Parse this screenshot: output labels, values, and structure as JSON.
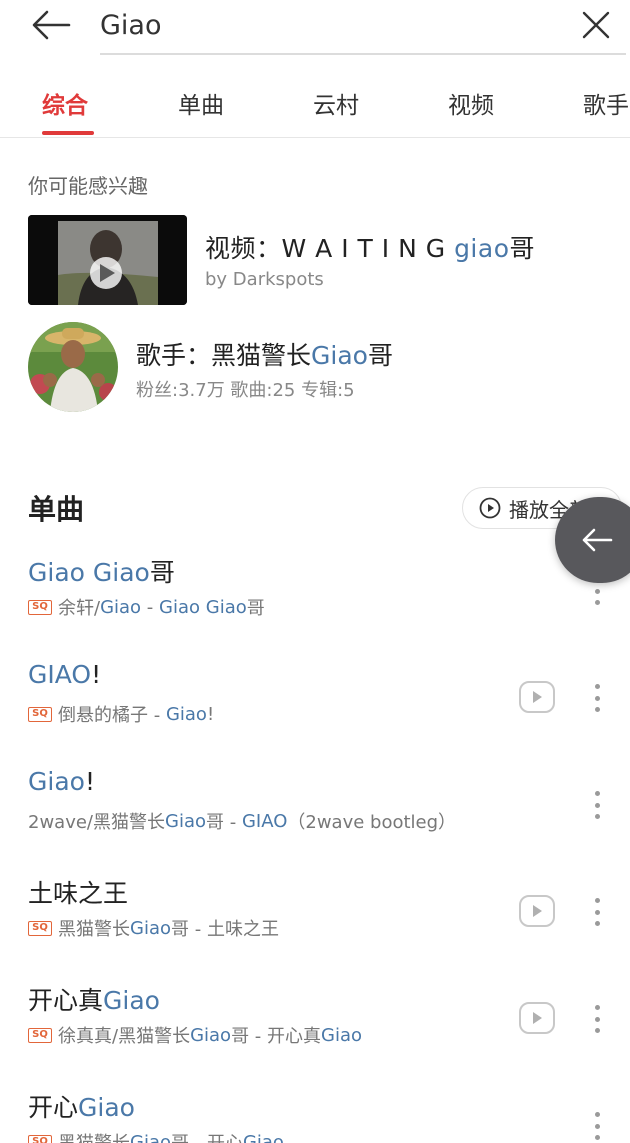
{
  "search": {
    "query": "Giao"
  },
  "tabs": [
    {
      "label": "综合",
      "active": true
    },
    {
      "label": "单曲",
      "active": false
    },
    {
      "label": "云村",
      "active": false
    },
    {
      "label": "视频",
      "active": false
    },
    {
      "label": "歌手",
      "active": false
    }
  ],
  "suggestions": {
    "heading": "你可能感兴趣",
    "video": {
      "prefix": "视频：",
      "title_plain": "W A I T I N G ",
      "title_highlight": "giao",
      "title_suffix": "哥",
      "by": "by Darkspots"
    },
    "artist": {
      "prefix": "歌手：",
      "name_plain": "黑猫警长",
      "name_highlight": "Giao",
      "name_suffix": "哥",
      "stats": "粉丝:3.7万 歌曲:25 专辑:5"
    }
  },
  "songs_section": {
    "heading": "单曲",
    "play_all": "播放全部"
  },
  "songs": [
    {
      "title": [
        {
          "t": "Giao Giao",
          "hl": true
        },
        {
          "t": "哥",
          "hl": false
        }
      ],
      "sub": [
        {
          "t": "余轩/",
          "hl": false
        },
        {
          "t": "Giao",
          "hl": true
        },
        {
          "t": " - ",
          "hl": false
        },
        {
          "t": "Giao Giao",
          "hl": true
        },
        {
          "t": "哥",
          "hl": false
        }
      ],
      "sq": true,
      "video": false
    },
    {
      "title": [
        {
          "t": "GIAO",
          "hl": true
        },
        {
          "t": "!",
          "hl": false
        }
      ],
      "sub": [
        {
          "t": "倒悬的橘子 - ",
          "hl": false
        },
        {
          "t": "Giao",
          "hl": true
        },
        {
          "t": "!",
          "hl": false
        }
      ],
      "sq": true,
      "video": true
    },
    {
      "title": [
        {
          "t": "Giao",
          "hl": true
        },
        {
          "t": "!",
          "hl": false
        }
      ],
      "sub": [
        {
          "t": "2wave/黑猫警长",
          "hl": false
        },
        {
          "t": "Giao",
          "hl": true
        },
        {
          "t": "哥 - ",
          "hl": false
        },
        {
          "t": "GIAO",
          "hl": true
        },
        {
          "t": "（2wave bootleg）",
          "hl": false
        }
      ],
      "sq": false,
      "video": false
    },
    {
      "title": [
        {
          "t": "土味之王",
          "hl": false
        }
      ],
      "sub": [
        {
          "t": "黑猫警长",
          "hl": false
        },
        {
          "t": "Giao",
          "hl": true
        },
        {
          "t": "哥 - 土味之王",
          "hl": false
        }
      ],
      "sq": true,
      "video": true
    },
    {
      "title": [
        {
          "t": "开心真",
          "hl": false
        },
        {
          "t": "Giao",
          "hl": true
        }
      ],
      "sub": [
        {
          "t": "徐真真/黑猫警长",
          "hl": false
        },
        {
          "t": "Giao",
          "hl": true
        },
        {
          "t": "哥 - 开心真",
          "hl": false
        },
        {
          "t": "Giao",
          "hl": true
        }
      ],
      "sq": true,
      "video": true
    },
    {
      "title": [
        {
          "t": "开心",
          "hl": false
        },
        {
          "t": "Giao",
          "hl": true
        }
      ],
      "sub": [
        {
          "t": "黑猫警长",
          "hl": false
        },
        {
          "t": "Giao",
          "hl": true
        },
        {
          "t": "哥 - 开心",
          "hl": false
        },
        {
          "t": "Giao",
          "hl": true
        }
      ],
      "sq": true,
      "video": false
    }
  ],
  "badges": {
    "sq_label": "SQ"
  },
  "colors": {
    "accent": "#e03a3a",
    "highlight": "#4a78a8",
    "sq_badge": "#e2663a"
  }
}
